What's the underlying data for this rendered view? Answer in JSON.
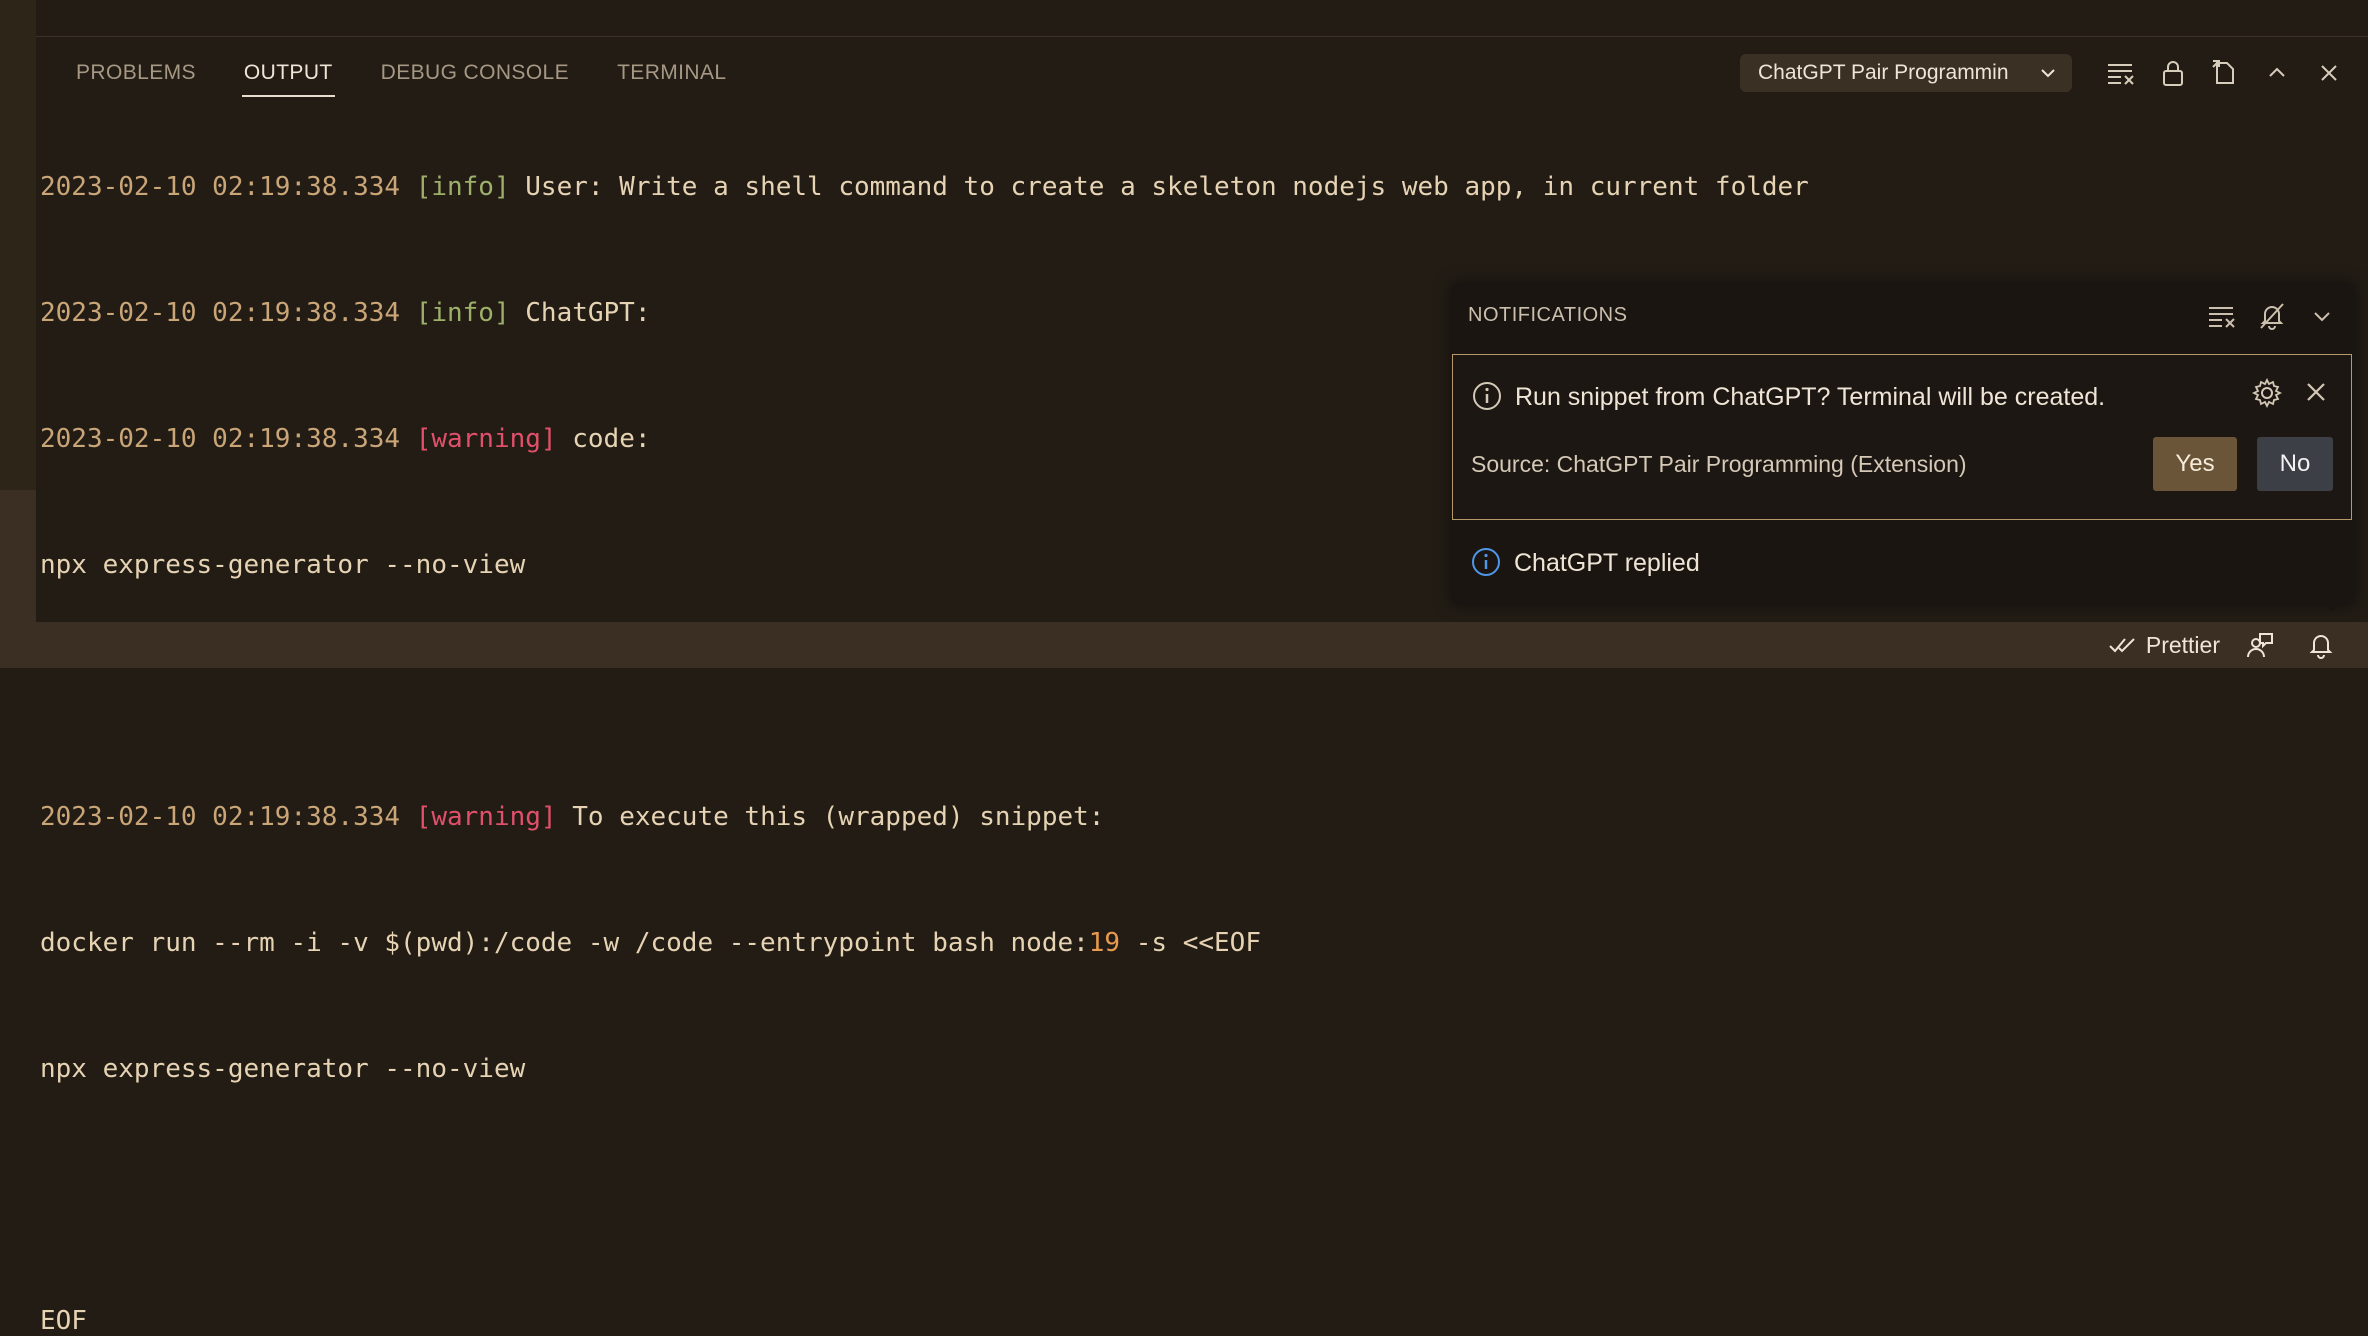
{
  "panel": {
    "tabs": [
      {
        "label": "PROBLEMS"
      },
      {
        "label": "OUTPUT"
      },
      {
        "label": "DEBUG CONSOLE"
      },
      {
        "label": "TERMINAL"
      }
    ],
    "active_tab": "OUTPUT",
    "channel_selector": "ChatGPT Pair Programmin"
  },
  "log": {
    "lines": [
      {
        "ts": "2023-02-10 02:19:38.334",
        "level": "[info]",
        "text": " User: Write a shell command to create a skeleton nodejs web app, in current folder"
      },
      {
        "ts": "2023-02-10 02:19:38.334",
        "level": "[info]",
        "text": " ChatGPT:"
      },
      {
        "ts": "2023-02-10 02:19:38.334",
        "level": "[warning]",
        "text": " code:"
      },
      {
        "plain": "npx express-generator --no-view"
      },
      {
        "plain": ""
      },
      {
        "ts": "2023-02-10 02:19:38.334",
        "level": "[warning]",
        "text": " To execute this (wrapped) snippet:"
      },
      {
        "docker_a": "docker run --rm -i -v $(pwd):/code -w /code --entrypoint bash node:",
        "docker_num": "19",
        "docker_b": " -s <<EOF"
      },
      {
        "plain": "npx express-generator --no-view"
      },
      {
        "plain": ""
      },
      {
        "plain": "EOF"
      }
    ]
  },
  "notifications": {
    "header": "NOTIFICATIONS",
    "toast": {
      "message": "Run snippet from ChatGPT? Terminal will be created.",
      "source": "Source: ChatGPT Pair Programming (Extension)",
      "yes_label": "Yes",
      "no_label": "No"
    },
    "second_message": "ChatGPT replied"
  },
  "statusbar": {
    "prettier": "Prettier"
  },
  "colors": {
    "accent_border": "#b89a6a",
    "warning": "#e0506a",
    "info": "#9db06a",
    "timestamp": "#c9a578"
  }
}
